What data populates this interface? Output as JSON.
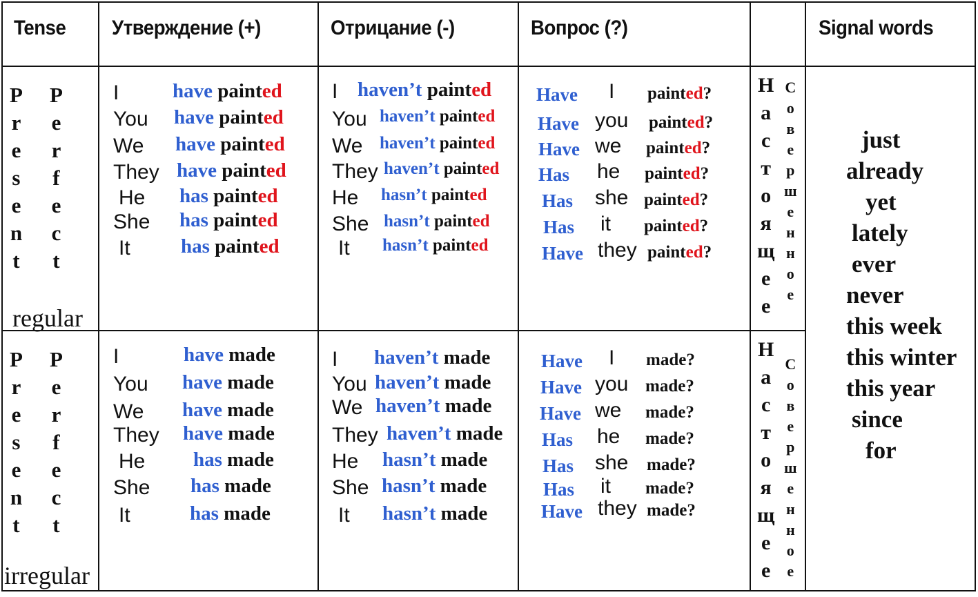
{
  "header": {
    "tense": "Tense",
    "affirmative": "Утверждение (+)",
    "negative": "Отрицание (-)",
    "question": "Вопрос (?)",
    "blank": "",
    "signal_words": "Signal words"
  },
  "rows": [
    {
      "tense_name_word1": [
        "P",
        "r",
        "e",
        "s",
        "e",
        "n",
        "t"
      ],
      "tense_name_word2": [
        "P",
        "e",
        "r",
        "f",
        "e",
        "c",
        "t"
      ],
      "verb_type": "regular",
      "russian_word1": [
        "Н",
        "а",
        "с",
        "т",
        "о",
        "я",
        "щ",
        "е",
        "е"
      ],
      "russian_word2": [
        "С",
        "о",
        "в",
        "е",
        "р",
        "ш",
        "е",
        "н",
        "н",
        "о",
        "е"
      ],
      "affirmative": [
        {
          "pronoun": "I",
          "aux": "have",
          "stem": "paint",
          "ending": "ed"
        },
        {
          "pronoun": "You",
          "aux": "have",
          "stem": "paint",
          "ending": "ed"
        },
        {
          "pronoun": "We",
          "aux": "have",
          "stem": "paint",
          "ending": "ed"
        },
        {
          "pronoun": "They",
          "aux": "have",
          "stem": "paint",
          "ending": "ed"
        },
        {
          "pronoun": "He",
          "aux": "has",
          "stem": "paint",
          "ending": "ed"
        },
        {
          "pronoun": "She",
          "aux": "has",
          "stem": "paint",
          "ending": "ed"
        },
        {
          "pronoun": "It",
          "aux": "has",
          "stem": "paint",
          "ending": "ed"
        }
      ],
      "negative": [
        {
          "pronoun": "I",
          "aux": "haven’t",
          "stem": "paint",
          "ending": "ed"
        },
        {
          "pronoun": "You",
          "aux": "haven’t",
          "stem": "paint",
          "ending": "ed"
        },
        {
          "pronoun": "We",
          "aux": "haven’t",
          "stem": "paint",
          "ending": "ed"
        },
        {
          "pronoun": "They",
          "aux": "haven’t",
          "stem": "paint",
          "ending": "ed"
        },
        {
          "pronoun": "He",
          "aux": "hasn’t",
          "stem": "paint",
          "ending": "ed"
        },
        {
          "pronoun": "She",
          "aux": "hasn’t",
          "stem": "paint",
          "ending": "ed"
        },
        {
          "pronoun": "It",
          "aux": "hasn’t",
          "stem": "paint",
          "ending": "ed"
        }
      ],
      "question": [
        {
          "aux": "Have",
          "pronoun": "I",
          "stem": "paint",
          "ending": "ed",
          "mark": "?"
        },
        {
          "aux": "Have",
          "pronoun": "you",
          "stem": "paint",
          "ending": "ed",
          "mark": "?"
        },
        {
          "aux": "Have",
          "pronoun": "we",
          "stem": "paint",
          "ending": "ed",
          "mark": "?"
        },
        {
          "aux": "Has",
          "pronoun": "he",
          "stem": "paint",
          "ending": "ed",
          "mark": "?"
        },
        {
          "aux": "Has",
          "pronoun": "she",
          "stem": "paint",
          "ending": "ed",
          "mark": "?"
        },
        {
          "aux": "Has",
          "pronoun": "it",
          "stem": "paint",
          "ending": "ed",
          "mark": "?"
        },
        {
          "aux": "Have",
          "pronoun": "they",
          "stem": "paint",
          "ending": "ed",
          "mark": "?"
        }
      ]
    },
    {
      "tense_name_word1": [
        "P",
        "r",
        "e",
        "s",
        "e",
        "n",
        "t"
      ],
      "tense_name_word2": [
        "P",
        "e",
        "r",
        "f",
        "e",
        "c",
        "t"
      ],
      "verb_type": "irregular",
      "russian_word1": [
        "Н",
        "а",
        "с",
        "т",
        "о",
        "я",
        "щ",
        "е",
        "е"
      ],
      "russian_word2": [
        "С",
        "о",
        "в",
        "е",
        "р",
        "ш",
        "е",
        "н",
        "н",
        "о",
        "е"
      ],
      "affirmative": [
        {
          "pronoun": "I",
          "aux": "have",
          "stem": "made",
          "ending": ""
        },
        {
          "pronoun": "You",
          "aux": "have",
          "stem": "made",
          "ending": ""
        },
        {
          "pronoun": "We",
          "aux": "have",
          "stem": "made",
          "ending": ""
        },
        {
          "pronoun": "They",
          "aux": "have",
          "stem": "made",
          "ending": ""
        },
        {
          "pronoun": "He",
          "aux": "has",
          "stem": "made",
          "ending": ""
        },
        {
          "pronoun": "She",
          "aux": "has",
          "stem": "made",
          "ending": ""
        },
        {
          "pronoun": "It",
          "aux": "has",
          "stem": "made",
          "ending": ""
        }
      ],
      "negative": [
        {
          "pronoun": "I",
          "aux": "haven’t",
          "stem": "made",
          "ending": ""
        },
        {
          "pronoun": "You",
          "aux": "haven’t",
          "stem": "made",
          "ending": ""
        },
        {
          "pronoun": "We",
          "aux": "haven’t",
          "stem": "made",
          "ending": ""
        },
        {
          "pronoun": "They",
          "aux": "haven’t",
          "stem": "made",
          "ending": ""
        },
        {
          "pronoun": "He",
          "aux": "hasn’t",
          "stem": "made",
          "ending": ""
        },
        {
          "pronoun": "She",
          "aux": "hasn’t",
          "stem": "made",
          "ending": ""
        },
        {
          "pronoun": "It",
          "aux": "hasn’t",
          "stem": "made",
          "ending": ""
        }
      ],
      "question": [
        {
          "aux": "Have",
          "pronoun": "I",
          "stem": "made",
          "ending": "",
          "mark": "?"
        },
        {
          "aux": "Have",
          "pronoun": "you",
          "stem": "made",
          "ending": "",
          "mark": "?"
        },
        {
          "aux": "Have",
          "pronoun": "we",
          "stem": "made",
          "ending": "",
          "mark": "?"
        },
        {
          "aux": "Has",
          "pronoun": "he",
          "stem": "made",
          "ending": "",
          "mark": "?"
        },
        {
          "aux": "Has",
          "pronoun": "she",
          "stem": "made",
          "ending": "",
          "mark": "?"
        },
        {
          "aux": "Has",
          "pronoun": "it",
          "stem": "made",
          "ending": "",
          "mark": "?"
        },
        {
          "aux": "Have",
          "pronoun": "they",
          "stem": "made",
          "ending": "",
          "mark": "?"
        }
      ]
    }
  ],
  "signal_words": [
    "just",
    "already",
    "yet",
    "lately",
    "ever",
    "never",
    "this week",
    "this winter",
    "this year",
    "since",
    "for"
  ],
  "colors": {
    "auxiliary": "#2f5fd0",
    "ending": "#e0141c",
    "text": "#111111",
    "grid": "#111111"
  }
}
